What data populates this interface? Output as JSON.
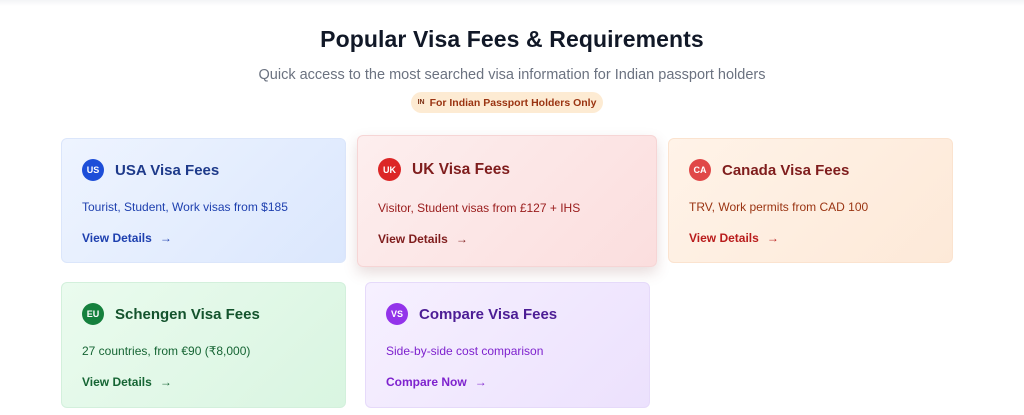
{
  "header": {
    "title": "Popular Visa Fees & Requirements",
    "subtitle": "Quick access to the most searched visa information for Indian passport holders",
    "badge_flag": "IN",
    "badge_text": "For Indian Passport Holders Only"
  },
  "cards": {
    "usa": {
      "code": "US",
      "title": "USA Visa Fees",
      "description": "Tourist, Student, Work visas from $185",
      "link": "View Details",
      "arrow": "→",
      "accent": "#1d4ed8"
    },
    "uk": {
      "code": "UK",
      "title": "UK Visa Fees",
      "description": "Visitor, Student visas from £127 + IHS",
      "link": "View Details",
      "arrow": "→",
      "accent": "#dc2626"
    },
    "canada": {
      "code": "CA",
      "title": "Canada Visa Fees",
      "description": "TRV, Work permits from CAD 100",
      "link": "View Details",
      "arrow": "→",
      "accent": "#e04848"
    },
    "schengen": {
      "code": "EU",
      "title": "Schengen Visa Fees",
      "description": "27 countries, from €90 (₹8,000)",
      "link": "View Details",
      "arrow": "→",
      "accent": "#15803d"
    },
    "compare": {
      "code": "VS",
      "title": "Compare Visa Fees",
      "description": "Side-by-side cost comparison",
      "link": "Compare Now",
      "arrow": "→",
      "accent": "#9333ea"
    }
  }
}
